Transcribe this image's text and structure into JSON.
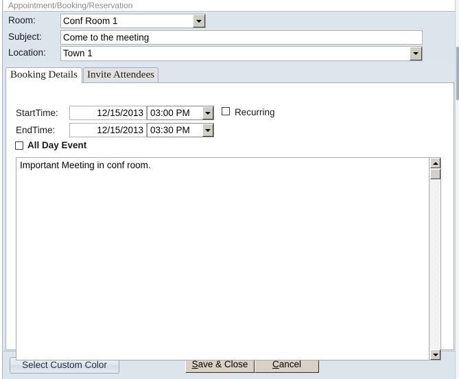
{
  "window": {
    "title": "Appointment/Booking/Reservation"
  },
  "header": {
    "room": {
      "label": "Room:",
      "value": "Conf Room 1"
    },
    "subject": {
      "label": "Subject:",
      "value": "Come to the meeting"
    },
    "location": {
      "label": "Location:",
      "value": "Town 1"
    }
  },
  "tabs": [
    {
      "label": "Booking Details",
      "active": true
    },
    {
      "label": "Invite Attendees",
      "active": false
    }
  ],
  "booking_details": {
    "start_time": {
      "label": "StartTime:",
      "date": "12/15/2013",
      "time": "03:00 PM"
    },
    "end_time": {
      "label": "EndTime:",
      "date": "12/15/2013",
      "time": "03:30 PM"
    },
    "recurring": {
      "label": "Recurring",
      "checked": false
    },
    "all_day_event": {
      "label": "All Day Event",
      "checked": false
    },
    "notes": {
      "value": "Important Meeting in conf room."
    }
  },
  "footer": {
    "select_custom_color": "Select Custom Color",
    "save_close_prefix": "S",
    "save_close_rest": "ave & Close",
    "cancel_prefix": "C",
    "cancel_rest": "ancel"
  },
  "colors": {
    "header_panel": "#dce4ec",
    "tab_active": "#ffffff",
    "tab_inactive": "#e2e2e2",
    "tab_border": "#9fb0c2",
    "classic_button": "#d9d2c4",
    "modern_button": "#dde5ee"
  }
}
